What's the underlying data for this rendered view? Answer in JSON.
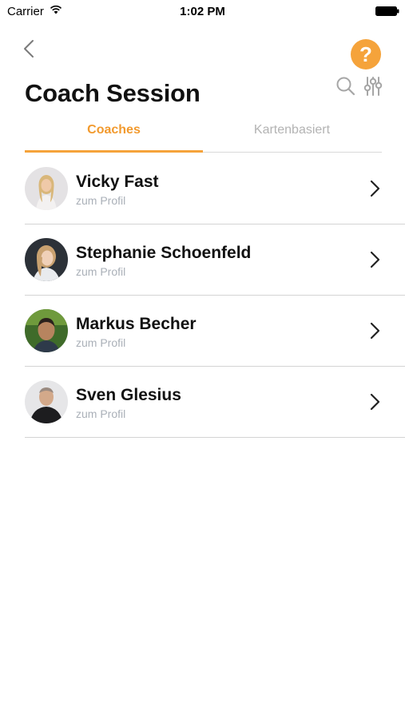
{
  "status_bar": {
    "carrier": "Carrier",
    "time": "1:02 PM"
  },
  "header": {
    "title": "Coach Session",
    "help_label": "?",
    "accent_color": "#f5a33b"
  },
  "tabs": [
    {
      "label": "Coaches",
      "active": true
    },
    {
      "label": "Kartenbasiert",
      "active": false
    }
  ],
  "coaches": [
    {
      "name": "Vicky Fast",
      "subtitle": "zum Profil"
    },
    {
      "name": "Stephanie Schoenfeld",
      "subtitle": "zum Profil"
    },
    {
      "name": "Markus Becher",
      "subtitle": "zum Profil"
    },
    {
      "name": "Sven Glesius",
      "subtitle": "zum Profil"
    }
  ]
}
